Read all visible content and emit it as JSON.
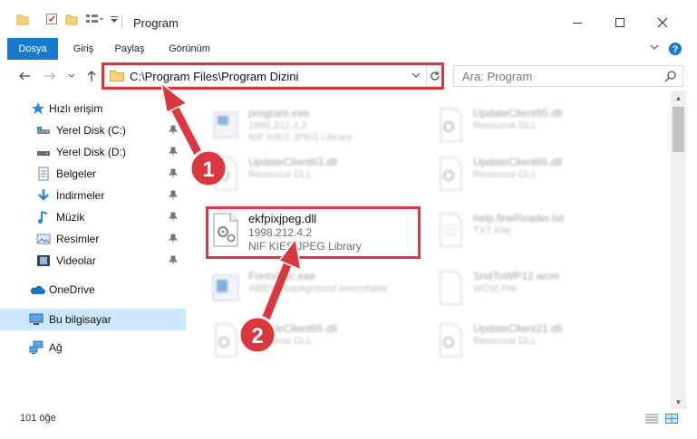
{
  "window": {
    "title": "Program"
  },
  "ribbon": {
    "tabs": [
      {
        "label": "Dosya"
      },
      {
        "label": "Giriş"
      },
      {
        "label": "Paylaş"
      },
      {
        "label": "Görünüm"
      }
    ]
  },
  "navbar": {
    "address": "C:\\Program Files\\Program Dizini",
    "search_placeholder": "Ara: Program"
  },
  "sidebar": {
    "items": [
      {
        "label": "Hızlı erişim",
        "icon": "star-icon",
        "pinned": false
      },
      {
        "label": "Yerel Disk (C:)",
        "icon": "drive-icon",
        "pinned": true
      },
      {
        "label": "Yerel Disk (D:)",
        "icon": "drive-icon",
        "pinned": true
      },
      {
        "label": "Belgeler",
        "icon": "documents-icon",
        "pinned": true
      },
      {
        "label": "İndirmeler",
        "icon": "download-icon",
        "pinned": true
      },
      {
        "label": "Müzik",
        "icon": "music-icon",
        "pinned": true
      },
      {
        "label": "Resimler",
        "icon": "pictures-icon",
        "pinned": true
      },
      {
        "label": "Videolar",
        "icon": "videos-icon",
        "pinned": true
      },
      {
        "label": "OneDrive",
        "icon": "cloud-icon",
        "pinned": false
      },
      {
        "label": "Bu bilgisayar",
        "icon": "computer-icon",
        "pinned": false,
        "selected": true
      },
      {
        "label": "Ağ",
        "icon": "network-icon",
        "pinned": false
      }
    ]
  },
  "files": [
    {
      "name": "program.exe",
      "line2": "1998.212.4.2",
      "line3": "NIF KIES JPEG Library"
    },
    {
      "name": "UpdateClient65.dll",
      "line2": "Resource DLL"
    },
    {
      "name": "UpdateClient63.dll",
      "line2": "Resource DLL"
    },
    {
      "name": "UpdateClient65.dll",
      "line2": "Resource DLL"
    },
    {
      "name": "ekfpixjpeg.dll",
      "line2": "1998.212.4.2",
      "line3": "NIF KIES JPEG Library"
    },
    {
      "name": "help.fineReader.txt",
      "line2": "TXT File"
    },
    {
      "name": "FontsRec.exe",
      "line2": "ABBYY background executable"
    },
    {
      "name": "SndToWP12.wcm",
      "line2": "WCM File"
    },
    {
      "name": "UpdateClient65.dll",
      "line2": "Resource DLL"
    },
    {
      "name": "UpdateClient21.dll",
      "line2": "Resource DLL"
    }
  ],
  "annotations": {
    "step1": "1",
    "step2": "2",
    "color": "#d9383f"
  },
  "status": {
    "count": "101 öğe"
  }
}
